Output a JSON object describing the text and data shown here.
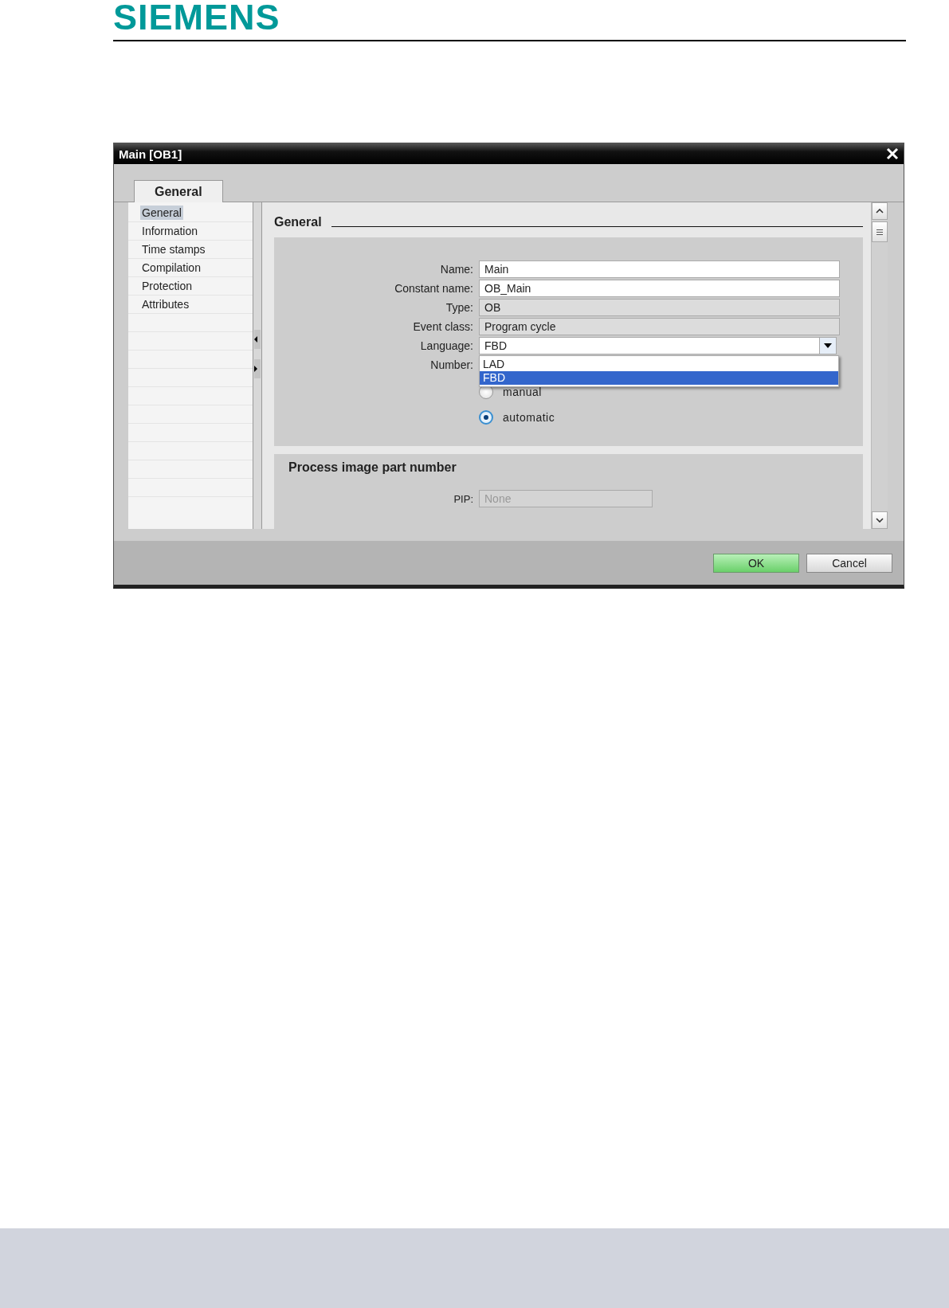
{
  "logo": "SIEMENS",
  "dialog": {
    "title": "Main [OB1]",
    "tabs": [
      {
        "label": "General",
        "selected": true
      }
    ],
    "nav": [
      {
        "label": "General",
        "selected": true
      },
      {
        "label": "Information",
        "selected": false
      },
      {
        "label": "Time stamps",
        "selected": false
      },
      {
        "label": "Compilation",
        "selected": false
      },
      {
        "label": "Protection",
        "selected": false
      },
      {
        "label": "Attributes",
        "selected": false
      }
    ],
    "section_title": "General",
    "fields": [
      {
        "label": "Name:",
        "value": "Main",
        "kind": "text"
      },
      {
        "label": "Constant name:",
        "value": "OB_Main",
        "kind": "text"
      },
      {
        "label": "Type:",
        "value": "OB",
        "kind": "readonly"
      },
      {
        "label": "Event class:",
        "value": "Program cycle",
        "kind": "readonly"
      },
      {
        "label": "Language:",
        "value": "FBD",
        "kind": "dropdown",
        "expanded": true,
        "options": [
          {
            "label": "LAD",
            "selected": false
          },
          {
            "label": "FBD",
            "selected": true
          }
        ]
      }
    ],
    "number": {
      "label": "Number:",
      "options": [
        {
          "label": "manual",
          "selected": false
        },
        {
          "label": "automatic",
          "selected": true
        }
      ]
    },
    "pip_section": {
      "title": "Process image part number",
      "label": "PIP:",
      "value": "None",
      "disabled": true
    },
    "buttons": [
      {
        "label": "OK",
        "kind": "primary"
      },
      {
        "label": "Cancel",
        "kind": "secondary"
      }
    ]
  }
}
